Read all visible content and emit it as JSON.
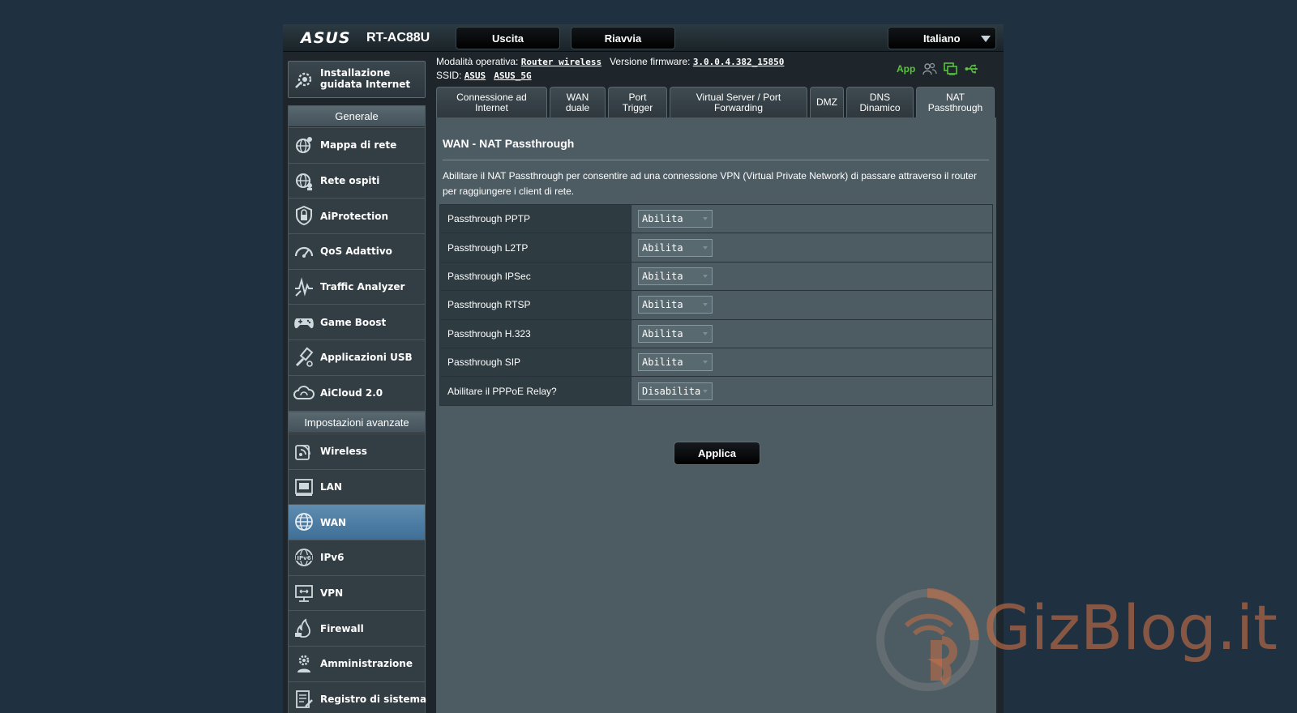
{
  "header": {
    "brand": "ASUS",
    "model": "RT-AC88U",
    "logout_label": "Uscita",
    "reboot_label": "Riavvia",
    "language": "Italiano"
  },
  "info": {
    "mode_label": "Modalità operativa:",
    "mode_value": "Router wireless",
    "firmware_label": "Versione firmware:",
    "firmware_value": "3.0.0.4.382_15850",
    "ssid_label": "SSID:",
    "ssid_1": "ASUS",
    "ssid_2": "ASUS_5G",
    "app_label": "App",
    "status_icons": [
      "users-icon",
      "network-status-icon",
      "usb-icon"
    ]
  },
  "sidebar": {
    "qis_label": "Installazione guidata Internet",
    "general_header": "Generale",
    "general_items": [
      {
        "label": "Mappa di rete",
        "icon": "network-map-icon"
      },
      {
        "label": "Rete ospiti",
        "icon": "guest-network-icon"
      },
      {
        "label": "AiProtection",
        "icon": "lock-shield-icon"
      },
      {
        "label": "QoS Adattivo",
        "icon": "gauge-icon"
      },
      {
        "label": "Traffic Analyzer",
        "icon": "traffic-analyzer-icon"
      },
      {
        "label": "Game Boost",
        "icon": "gamepad-icon"
      },
      {
        "label": "Applicazioni USB",
        "icon": "usb-apps-icon"
      },
      {
        "label": "AiCloud 2.0",
        "icon": "cloud-icon"
      }
    ],
    "advanced_header": "Impostazioni avanzate",
    "advanced_items": [
      {
        "label": "Wireless",
        "icon": "wireless-icon"
      },
      {
        "label": "LAN",
        "icon": "lan-port-icon"
      },
      {
        "label": "WAN",
        "icon": "globe-icon",
        "active": true
      },
      {
        "label": "IPv6",
        "icon": "ipv6-globe-icon"
      },
      {
        "label": "VPN",
        "icon": "vpn-monitor-icon"
      },
      {
        "label": "Firewall",
        "icon": "fire-icon"
      },
      {
        "label": "Amministrazione",
        "icon": "admin-gear-icon"
      },
      {
        "label": "Registro di sistema",
        "icon": "system-log-icon"
      }
    ]
  },
  "tabs": [
    {
      "label": "Connessione ad\nInternet"
    },
    {
      "label": "WAN\nduale"
    },
    {
      "label": "Port\nTrigger"
    },
    {
      "label": "Virtual Server / Port\nForwarding"
    },
    {
      "label": "DMZ"
    },
    {
      "label": "DNS\nDinamico"
    },
    {
      "label": "NAT\nPassthrough",
      "active": true
    }
  ],
  "main": {
    "title": "WAN - NAT Passthrough",
    "description": "Abilitare il NAT Passthrough per consentire ad una connessione VPN (Virtual Private Network) di passare attraverso il router per raggiungere i client di rete.",
    "rows": [
      {
        "label": "Passthrough PPTP",
        "value": "Abilita"
      },
      {
        "label": "Passthrough L2TP",
        "value": "Abilita"
      },
      {
        "label": "Passthrough IPSec",
        "value": "Abilita"
      },
      {
        "label": "Passthrough RTSP",
        "value": "Abilita"
      },
      {
        "label": "Passthrough H.323",
        "value": "Abilita"
      },
      {
        "label": "Passthrough SIP",
        "value": "Abilita"
      },
      {
        "label": "Abilitare il PPPoE Relay?",
        "value": "Disabilita"
      }
    ],
    "apply_label": "Applica"
  },
  "watermark": {
    "text": "GizBlog.it"
  },
  "colors": {
    "background": "#1f3140",
    "panel": "#4d5b62",
    "active_nav": "#4f80a8",
    "app_green": "#58c33b",
    "watermark": "#c87046"
  }
}
